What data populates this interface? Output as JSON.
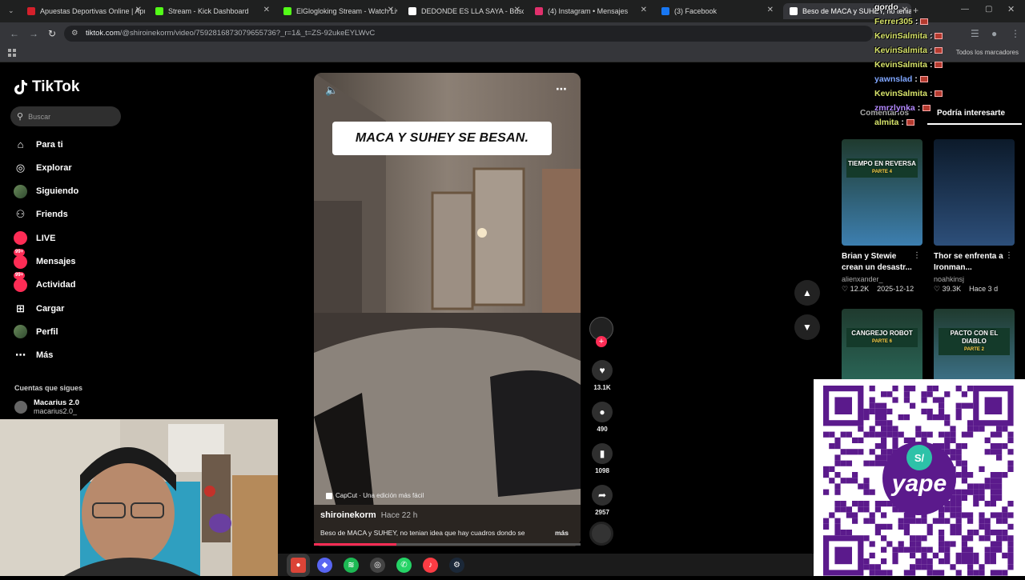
{
  "browser": {
    "tabs": [
      {
        "label": "Apuestas Deportivas Online | Apuesta...",
        "favicon_color": "#d4202b"
      },
      {
        "label": "Stream - Kick Dashboard",
        "favicon_color": "#53fc18"
      },
      {
        "label": "ElGlogloking Stream - Watch Live on Kick",
        "favicon_color": "#53fc18"
      },
      {
        "label": "DEDONDE ES LLA SAYA - Buscar con Google",
        "favicon_color": "#ffffff"
      },
      {
        "label": "(4) Instagram • Mensajes",
        "favicon_color": "#e1306c"
      },
      {
        "label": "(3) Facebook",
        "favicon_color": "#1877f2"
      },
      {
        "label": "Beso de MACA y SUHEY, no tenian",
        "favicon_color": "#ffffff"
      }
    ],
    "url_host": "tiktok.com",
    "url_path": "/@shiroinekorm/video/7592816873079655736?_r=1&_t=ZS-92ukeEYLWvC",
    "all_bookmarks": "Todos los marcadores"
  },
  "tiktok": {
    "logo": "TikTok",
    "search_placeholder": "Buscar",
    "nav": [
      {
        "label": "Para ti",
        "icon": "home-icon"
      },
      {
        "label": "Explorar",
        "icon": "compass-icon"
      },
      {
        "label": "Siguiendo",
        "icon": "avatar"
      },
      {
        "label": "Friends",
        "icon": "friends-icon"
      },
      {
        "label": "LIVE",
        "icon": "live-icon"
      },
      {
        "label": "Mensajes",
        "icon": "message-icon",
        "badge": "99+"
      },
      {
        "label": "Actividad",
        "icon": "activity-icon",
        "badge": "99+"
      },
      {
        "label": "Cargar",
        "icon": "upload-icon"
      },
      {
        "label": "Perfil",
        "icon": "avatar"
      },
      {
        "label": "Más",
        "icon": "more-icon"
      }
    ],
    "following_title": "Cuentas que sigues",
    "followed_account": {
      "name": "Macarius 2.0",
      "handle": "macarius2.0_"
    }
  },
  "video": {
    "overlay_title": "MACA Y SUHEY SE BESAN.",
    "capcut_label": "CapCut · Una edición más fácil",
    "author": "shiroinekorm",
    "posted": "Hace 22 h",
    "description": "Beso de MACA y SUHEY, no tenian idea que hay cuadros dondo se",
    "more": "más",
    "progress_fraction": 0.31,
    "likes": "13.1K",
    "comments": "490",
    "saves": "1098",
    "shares": "2957"
  },
  "right_panel": {
    "tabs": [
      "Comentarios",
      "Podría interesarte"
    ],
    "cards": [
      {
        "title": "Brian y Stewie crean un desastr...",
        "author": "alienxander_",
        "likes": "12.2K",
        "date": "2025-12-12",
        "banner": "TIEMPO EN REVERSA",
        "banner_sub": "PARTE 4"
      },
      {
        "title": "Thor se enfrenta a Ironman...",
        "author": "noahkinsj",
        "likes": "39.3K",
        "date": "Hace 3 d",
        "banner": "",
        "banner_sub": ""
      },
      {
        "title": "",
        "author": "",
        "likes": "",
        "date": "",
        "banner": "CANGREJO ROBOT",
        "banner_sub": "PARTE 6"
      },
      {
        "title": "",
        "author": "",
        "likes": "",
        "date": "",
        "banner": "PACTO CON EL DIABLO",
        "banner_sub": "PARTE 2"
      }
    ]
  },
  "chat": [
    {
      "user": "gordo",
      "color": "#ffffff",
      "text": ""
    },
    {
      "user": "Ferrer305",
      "color": "#d7e36a",
      "text": ":"
    },
    {
      "user": "KevinSalmita",
      "color": "#d7e36a",
      "text": ":"
    },
    {
      "user": "KevinSalmita",
      "color": "#d7e36a",
      "text": ":"
    },
    {
      "user": "KevinSalmita",
      "color": "#d7e36a",
      "text": ":"
    },
    {
      "user": "yawnslad",
      "color": "#7fa6ff",
      "text": ":"
    },
    {
      "user": "KevinSalmita",
      "color": "#d7e36a",
      "text": ":"
    },
    {
      "user": "zmrzlynka",
      "color": "#b388ff",
      "text": ":"
    },
    {
      "user": "almita",
      "color": "#d7e36a",
      "text": ":"
    }
  ],
  "qr": {
    "brand": "yape",
    "mark": "S/"
  }
}
